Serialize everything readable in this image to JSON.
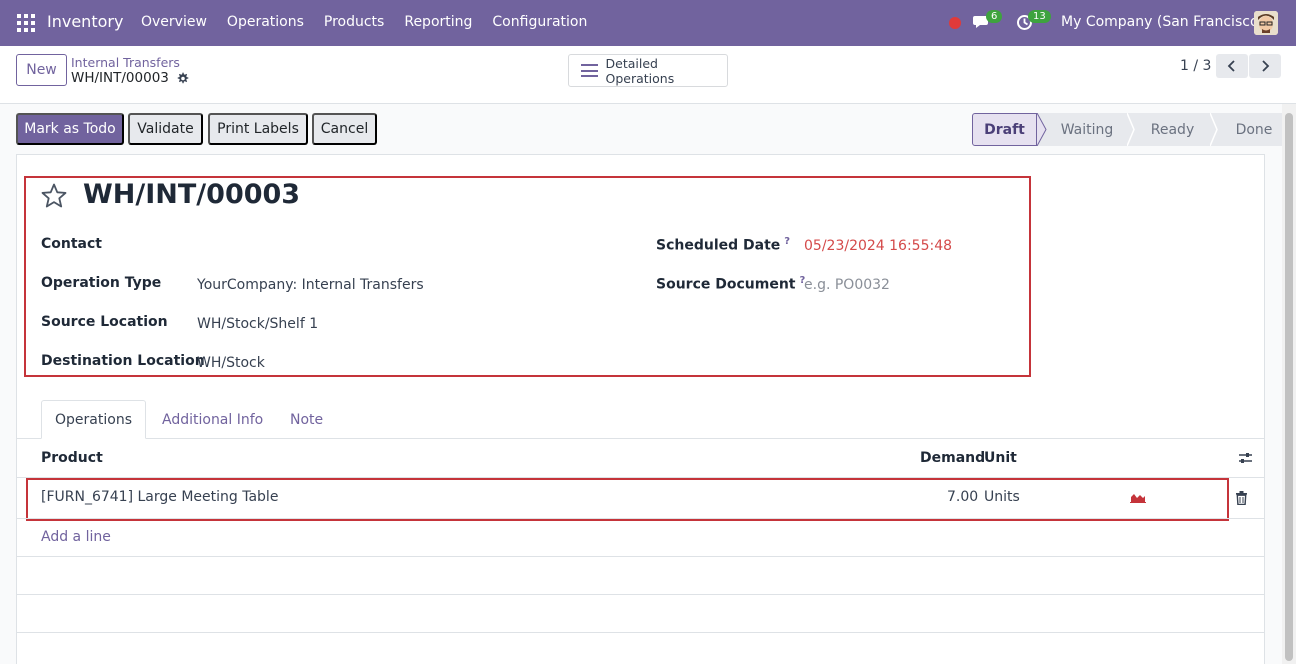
{
  "navbar": {
    "brand": "Inventory",
    "menu": [
      "Overview",
      "Operations",
      "Products",
      "Reporting",
      "Configuration"
    ],
    "chat_count": "6",
    "activity_count": "13",
    "company": "My Company (San Francisco)"
  },
  "control": {
    "new_label": "New",
    "breadcrumb": "Internal Transfers",
    "record_name": "WH/INT/00003",
    "detailed_label": "Detailed Operations",
    "pager": "1 / 3"
  },
  "actions": {
    "mark_todo": "Mark as Todo",
    "validate": "Validate",
    "print_labels": "Print Labels",
    "cancel": "Cancel"
  },
  "status": {
    "stages": [
      "Draft",
      "Waiting",
      "Ready",
      "Done"
    ],
    "current": "Draft"
  },
  "form": {
    "title": "WH/INT/00003",
    "contact_label": "Contact",
    "contact_value": "",
    "operation_type_label": "Operation Type",
    "operation_type_value": "YourCompany: Internal Transfers",
    "source_location_label": "Source Location",
    "source_location_value": "WH/Stock/Shelf 1",
    "destination_location_label": "Destination Location",
    "destination_location_value": "WH/Stock",
    "scheduled_date_label": "Scheduled Date",
    "scheduled_date_value": "05/23/2024 16:55:48",
    "source_document_label": "Source Document",
    "source_document_placeholder": "e.g. PO0032",
    "help_mark": "?"
  },
  "tabs": [
    "Operations",
    "Additional Info",
    "Note"
  ],
  "table": {
    "headers": {
      "product": "Product",
      "demand": "Demand",
      "unit": "Unit"
    },
    "rows": [
      {
        "product": "[FURN_6741] Large Meeting Table",
        "demand": "7.00",
        "unit": "Units"
      }
    ],
    "add_line": "Add a line"
  },
  "colors": {
    "brand": "#71639e",
    "highlight": "#c5343a",
    "date": "#d44a4a"
  }
}
